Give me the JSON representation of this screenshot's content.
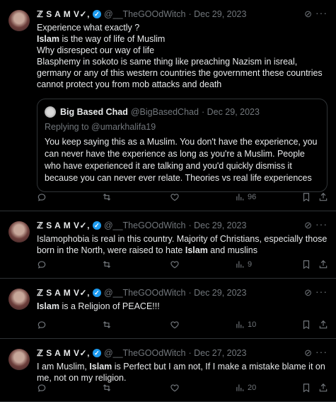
{
  "tweets": [
    {
      "author": "ℤ S A M V✓,",
      "handle": "@__TheGOOdWitch",
      "date": "· Dec 29, 2023",
      "text": "Experience what exactly ?\n<b>Islam</b> is the way of life of Muslim\nWhy disrespect our way of life\nBlasphemy in sokoto is same thing like preaching Nazism in isreal, germany or any of this western countries the government these countries cannot protect you from mob attacks and death",
      "quote": {
        "author": "Big Based Chad",
        "handle": "@BigBasedChad",
        "date": "· Dec 29, 2023",
        "replying_to": "Replying to @umarkhalifa19",
        "text": "You keep saying this as a Muslim. You don't have the experience, you can never have the experience as long as you're a Muslim. People who have experienced it are talking and you'd quickly dismiss it because you can never ever relate. Theories vs real life experiences"
      },
      "views": "96"
    },
    {
      "author": "ℤ S A M V✓,",
      "handle": "@__TheGOOdWitch",
      "date": "· Dec 29, 2023",
      "text": "Islamophobia is real in this country. Majority of Christians, especially those born in the North, were raised to hate <b>Islam</b> and muslins",
      "views": "9"
    },
    {
      "author": "ℤ S A M V✓,",
      "handle": "@__TheGOOdWitch",
      "date": "· Dec 29, 2023",
      "text": "<b>Islam</b> is a Religion of PEACE!!!",
      "views": "10"
    },
    {
      "author": "ℤ S A M V✓,",
      "handle": "@__TheGOOdWitch",
      "date": "· Dec 27, 2023",
      "text": "I am Muslim, <b>Islam</b> is Perfect but I am not, If I make a mistake blame it on me, not on my religion.",
      "views": "20"
    }
  ]
}
